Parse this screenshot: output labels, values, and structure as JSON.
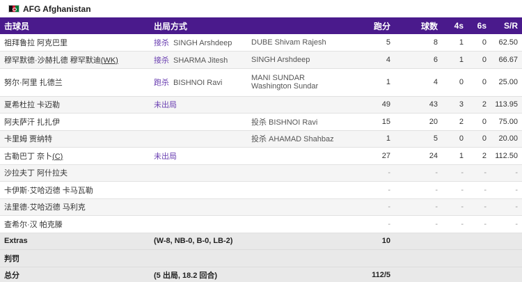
{
  "team": {
    "name": "AFG Afghanistan"
  },
  "columns": {
    "batter": "击球员",
    "how": "出局方式",
    "runs": "跑分",
    "balls": "球数",
    "fours": "4s",
    "sixes": "6s",
    "sr": "S/R"
  },
  "batters": [
    {
      "name": "祖拜鲁拉 阿克巴里",
      "mode": "接杀",
      "fielder": "SINGH Arshdeep",
      "bowler": "DUBE Shivam Rajesh",
      "runs": "5",
      "balls": "8",
      "fours": "1",
      "sixes": "0",
      "sr": "62.50"
    },
    {
      "name": "穆罕默德·沙赫扎德 穆罕默迪",
      "suffix": "(WK)",
      "mode": "接杀",
      "fielder": "SHARMA Jitesh",
      "bowler": "SINGH Arshdeep",
      "runs": "4",
      "balls": "6",
      "fours": "1",
      "sixes": "0",
      "sr": "66.67"
    },
    {
      "name": "努尔·阿里 扎德兰",
      "mode": "跑杀",
      "fielder": "BISHNOI Ravi",
      "bowler": "MANI SUNDAR",
      "bowler2": "Washington Sundar",
      "runs": "1",
      "balls": "4",
      "fours": "0",
      "sixes": "0",
      "sr": "25.00"
    },
    {
      "name": "夏希杜拉 卡迈勒",
      "mode": "未出局",
      "fielder": "",
      "bowler": "",
      "runs": "49",
      "balls": "43",
      "fours": "3",
      "sixes": "2",
      "sr": "113.95"
    },
    {
      "name": "阿夫萨汗 扎扎伊",
      "mode": "",
      "fielder": "",
      "bowler": "投杀  BISHNOI Ravi",
      "runs": "15",
      "balls": "20",
      "fours": "2",
      "sixes": "0",
      "sr": "75.00"
    },
    {
      "name": "卡里姆 贾纳特",
      "mode": "",
      "fielder": "",
      "bowler": "投杀  AHAMAD Shahbaz",
      "runs": "1",
      "balls": "5",
      "fours": "0",
      "sixes": "0",
      "sr": "20.00"
    },
    {
      "name": "古勒巴丁 奈卜",
      "suffix": "(C)",
      "mode": "未出局",
      "fielder": "",
      "bowler": "",
      "runs": "27",
      "balls": "24",
      "fours": "1",
      "sixes": "2",
      "sr": "112.50"
    },
    {
      "name": "沙拉夫丁 阿什拉夫",
      "mode": "",
      "fielder": "",
      "bowler": "",
      "runs": "-",
      "balls": "-",
      "fours": "-",
      "sixes": "-",
      "sr": "-"
    },
    {
      "name": "卡伊斯·艾哈迈德 卡马瓦勒",
      "mode": "",
      "fielder": "",
      "bowler": "",
      "runs": "-",
      "balls": "-",
      "fours": "-",
      "sixes": "-",
      "sr": "-"
    },
    {
      "name": "法里德·艾哈迈德 马利克",
      "mode": "",
      "fielder": "",
      "bowler": "",
      "runs": "-",
      "balls": "-",
      "fours": "-",
      "sixes": "-",
      "sr": "-"
    },
    {
      "name": "查希尔·汉 帕克滕",
      "mode": "",
      "fielder": "",
      "bowler": "",
      "runs": "-",
      "balls": "-",
      "fours": "-",
      "sixes": "-",
      "sr": "-"
    }
  ],
  "extras": {
    "label": "Extras",
    "detail": "(W-8, NB-0, B-0, LB-2)",
    "value": "10"
  },
  "penalty": {
    "label": "判罚"
  },
  "total": {
    "label": "总分",
    "detail": "(5 出局, 18.2 回合)",
    "value": "112/5"
  },
  "colors": {
    "header_bg": "#4a1a8c",
    "mode_text": "#6a3fb1"
  }
}
